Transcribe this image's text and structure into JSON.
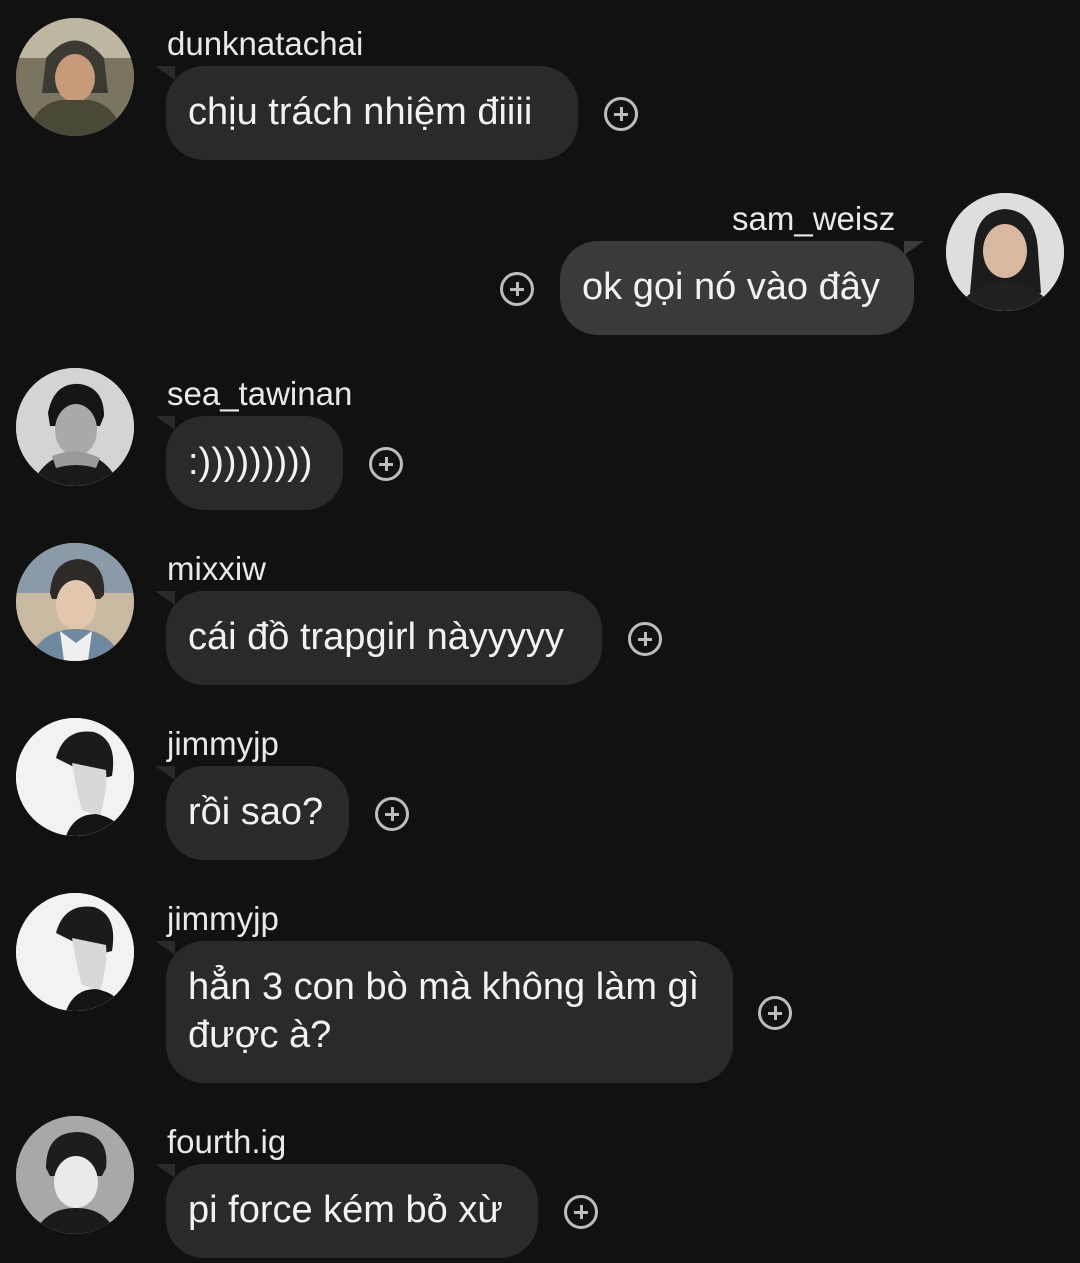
{
  "messages": [
    {
      "user": "dunknatachai",
      "text": "chịu trách nhiệm điiii",
      "avatar": "avatar-dunknatachai",
      "side": "left"
    },
    {
      "user": "sam_weisz",
      "text": "ok gọi nó vào đây",
      "avatar": "avatar-sam-weisz",
      "side": "right"
    },
    {
      "user": "sea_tawinan",
      "text": ":)))))))))",
      "avatar": "avatar-sea-tawinan",
      "side": "left"
    },
    {
      "user": "mixxiw",
      "text": "cái đồ trapgirl nàyyyyy",
      "avatar": "avatar-mixxiw",
      "side": "left"
    },
    {
      "user": "jimmyjp",
      "text": "rồi sao?",
      "avatar": "avatar-jimmyjp",
      "side": "left"
    },
    {
      "user": "jimmyjp",
      "text": "hẳn 3 con bò mà không làm gì được à?",
      "avatar": "avatar-jimmyjp",
      "side": "left"
    },
    {
      "user": "fourth.ig",
      "text": "pi force kém bỏ xừ",
      "avatar": "avatar-fourth-ig",
      "side": "left"
    }
  ],
  "icons": {
    "react": "add-reaction-icon"
  },
  "colors": {
    "background": "#111111",
    "bubble": "#2a2a2a",
    "bubble_mine": "#3a3a3a",
    "text": "#f2f2f2"
  }
}
